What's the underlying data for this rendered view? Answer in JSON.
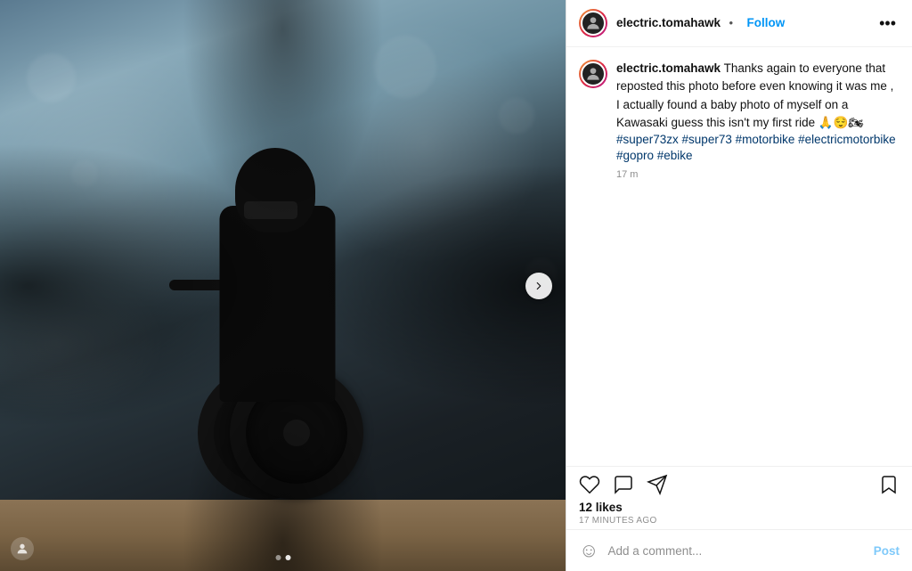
{
  "photo": {
    "alt": "Person on electric motorcycle shot from low angle through glass"
  },
  "header": {
    "username": "electric.tomahawk",
    "dot": "•",
    "follow_label": "Follow",
    "more_icon": "•••"
  },
  "caption": {
    "username": "electric.tomahawk",
    "body": " Thanks again to everyone that reposted this photo before even knowing it was me , I actually found a baby photo of myself on a Kawasaki guess this isn't my first ride 🙏😌🏍 ",
    "hashtags": "#super73zx #super73 #motorbike #electricmotorbike #gopro #ebike",
    "time": "17 m"
  },
  "actions": {
    "likes_count": "12 likes",
    "time_ago": "17 MINUTES AGO"
  },
  "comment_placeholder": "Add a comment...",
  "post_label": "Post",
  "dots": [
    "inactive",
    "active"
  ],
  "nav_arrow": "›"
}
